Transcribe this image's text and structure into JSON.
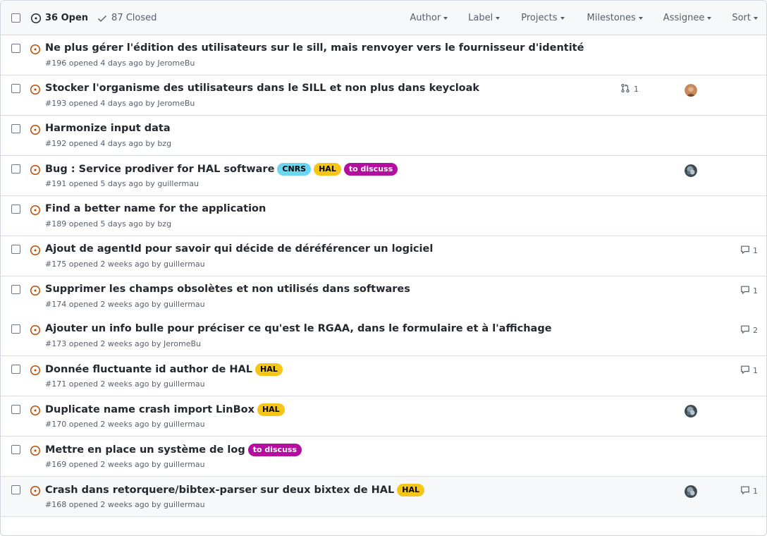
{
  "header": {
    "open_label": "36 Open",
    "closed_label": "87 Closed",
    "filters": [
      "Author",
      "Label",
      "Projects",
      "Milestones",
      "Assignee",
      "Sort"
    ]
  },
  "colors": {
    "open_icon": "#bc4c00",
    "label_cnrs": "#6ad6f0",
    "label_hal": "#f5c518",
    "label_discuss": "#b40e9e"
  },
  "issues": [
    {
      "title": "Ne plus gérer l'édition des utilisateurs sur le sill, mais renvoyer vers le fournisseur d'identité",
      "number": "#196",
      "opened": "opened 4 days ago by",
      "author": "JeromeBu"
    },
    {
      "title": "Stocker l'organisme des utilisateurs dans le SILL et non plus dans keycloak",
      "number": "#193",
      "opened": "opened 4 days ago by",
      "author": "JeromeBu",
      "linked_prs": "1",
      "assignee_avatar": "avatar-orange"
    },
    {
      "title": "Harmonize input data",
      "number": "#192",
      "opened": "opened 4 days ago by",
      "author": "bzg"
    },
    {
      "title": "Bug : Service prodiver for HAL software",
      "number": "#191",
      "opened": "opened 5 days ago by",
      "author": "guillermau",
      "labels": [
        "CNRS",
        "HAL",
        "to discuss"
      ],
      "assignee_avatar": "avatar-gray"
    },
    {
      "title": "Find a better name for the application",
      "number": "#189",
      "opened": "opened 5 days ago by",
      "author": "bzg"
    },
    {
      "title": "Ajout de agentId pour savoir qui décide de déréférencer un logiciel",
      "number": "#175",
      "opened": "opened 2 weeks ago by",
      "author": "guillermau",
      "comments": "1"
    },
    {
      "title": "Supprimer les champs obsolètes et non utilisés dans softwares",
      "number": "#174",
      "opened": "opened 2 weeks ago by",
      "author": "guillermau",
      "comments": "1"
    },
    {
      "title": "Ajouter un info bulle pour préciser ce qu'est le RGAA, dans le formulaire et à l'affichage",
      "number": "#173",
      "opened": "opened 2 weeks ago by",
      "author": "JeromeBu",
      "comments": "2"
    },
    {
      "title": "Donnée fluctuante id author de HAL",
      "number": "#171",
      "opened": "opened 2 weeks ago by",
      "author": "guillermau",
      "labels": [
        "HAL"
      ],
      "comments": "1"
    },
    {
      "title": "Duplicate name crash import LinBox",
      "number": "#170",
      "opened": "opened 2 weeks ago by",
      "author": "guillermau",
      "labels": [
        "HAL"
      ],
      "assignee_avatar": "avatar-gray"
    },
    {
      "title": "Mettre en place un système de log",
      "number": "#169",
      "opened": "opened 2 weeks ago by",
      "author": "guillermau",
      "labels": [
        "to discuss"
      ]
    },
    {
      "title": "Crash dans retorquere/bibtex-parser sur deux bixtex de HAL",
      "number": "#168",
      "opened": "opened 2 weeks ago by",
      "author": "guillermau",
      "labels": [
        "HAL"
      ],
      "assignee_avatar": "avatar-gray",
      "comments": "1"
    }
  ]
}
